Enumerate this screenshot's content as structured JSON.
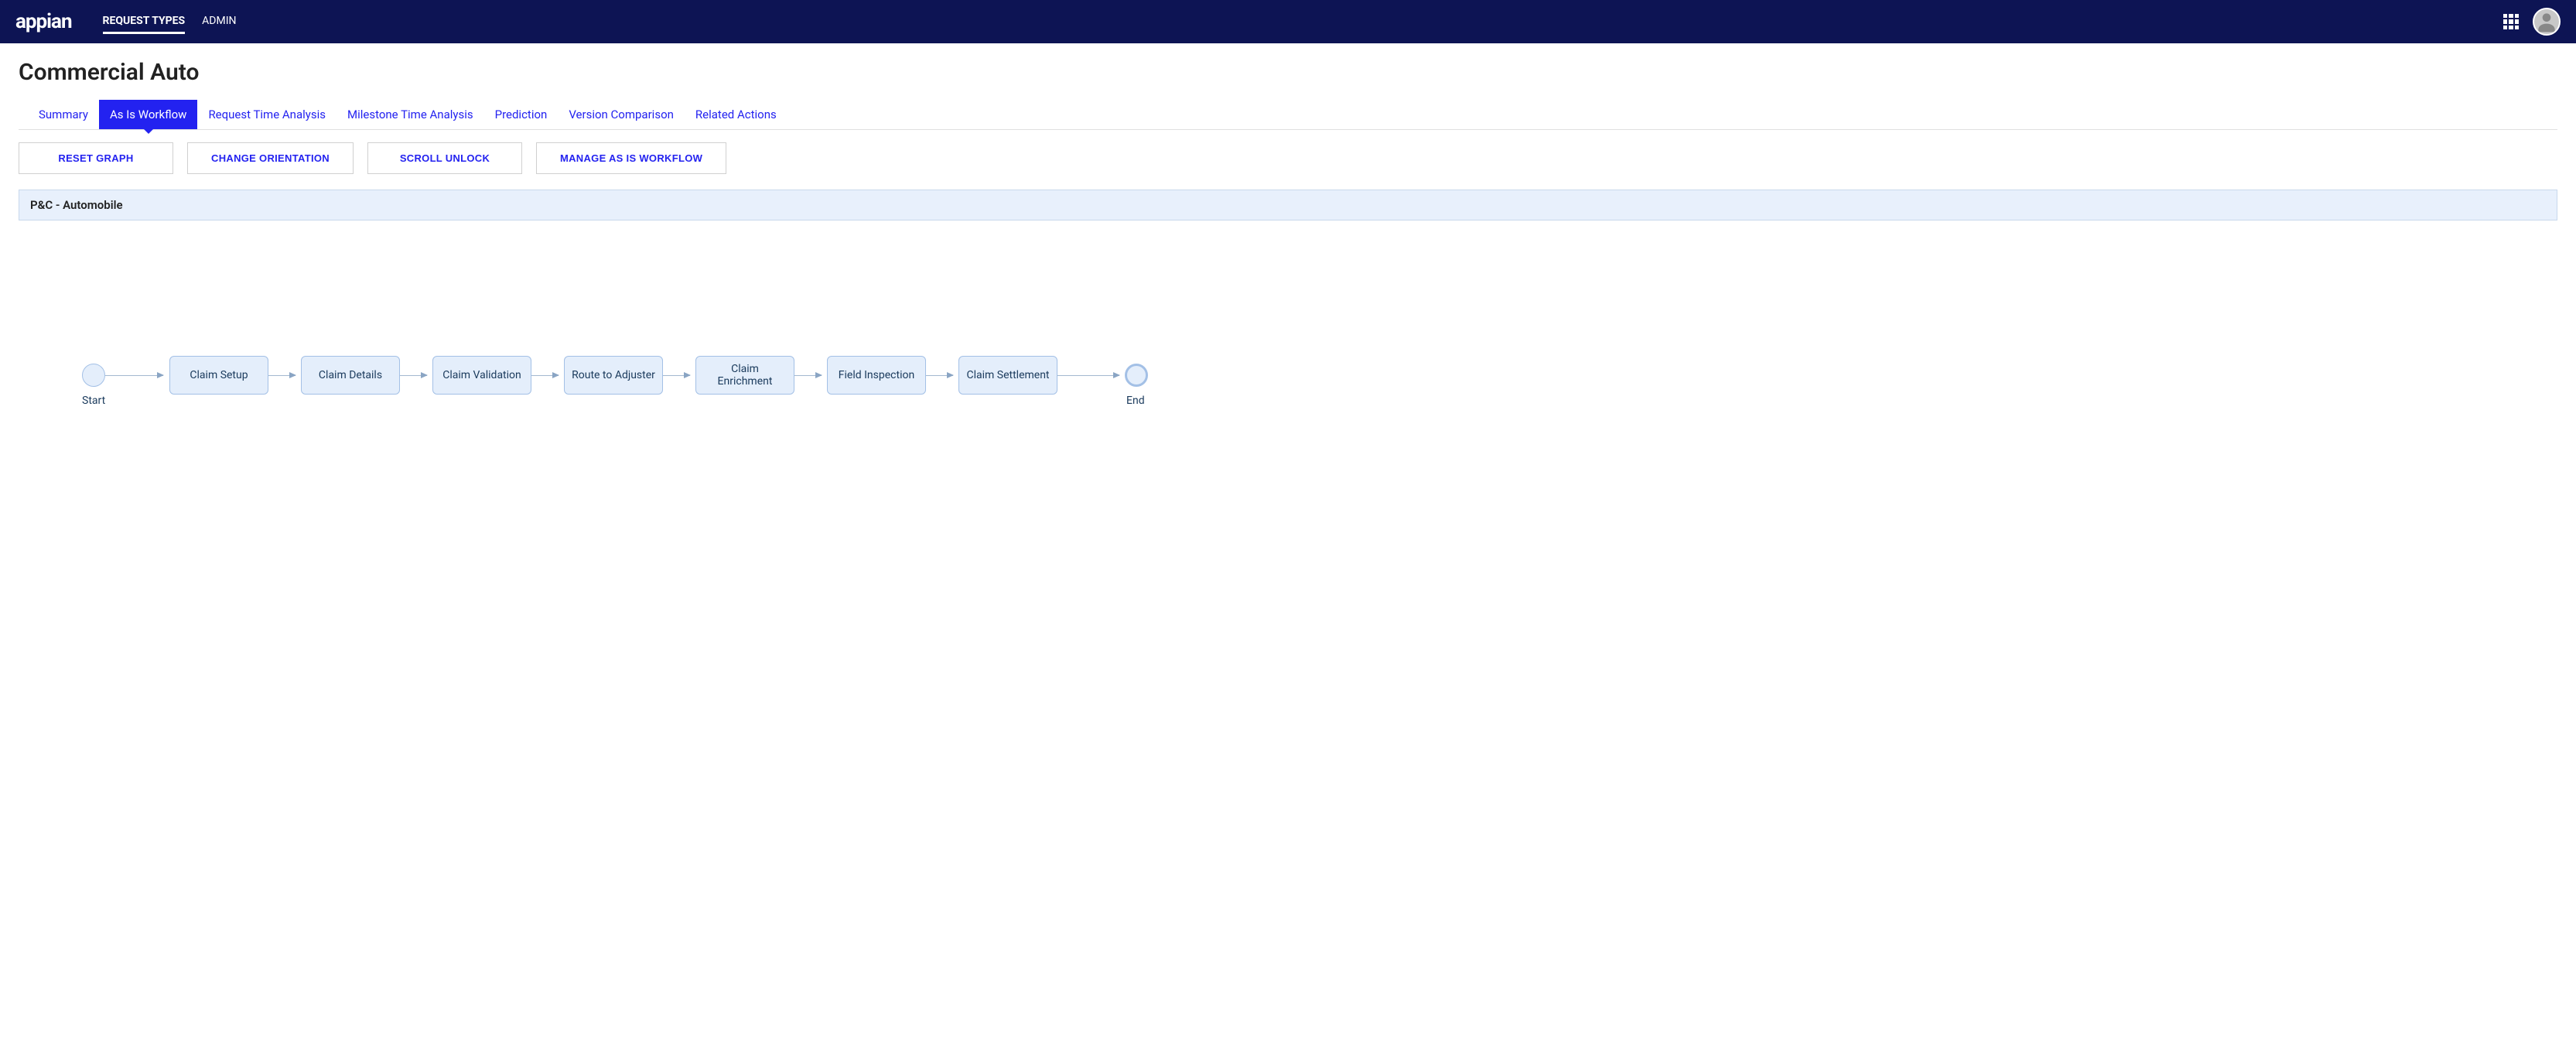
{
  "header": {
    "logo_text": "appian",
    "nav_items": [
      {
        "label": "REQUEST TYPES",
        "active": true
      },
      {
        "label": "ADMIN",
        "active": false
      }
    ]
  },
  "page": {
    "title": "Commercial Auto"
  },
  "tabs": [
    {
      "label": "Summary",
      "active": false
    },
    {
      "label": "As Is Workflow",
      "active": true
    },
    {
      "label": "Request Time Analysis",
      "active": false
    },
    {
      "label": "Milestone Time Analysis",
      "active": false
    },
    {
      "label": "Prediction",
      "active": false
    },
    {
      "label": "Version Comparison",
      "active": false
    },
    {
      "label": "Related Actions",
      "active": false
    }
  ],
  "actions": {
    "reset": "RESET GRAPH",
    "orientation": "CHANGE ORIENTATION",
    "scroll": "SCROLL UNLOCK",
    "manage": "MANAGE AS IS WORKFLOW"
  },
  "workflow": {
    "header": "P&C - Automobile",
    "start_label": "Start",
    "end_label": "End",
    "nodes": [
      {
        "label": "Claim Setup"
      },
      {
        "label": "Claim Details"
      },
      {
        "label": "Claim Validation"
      },
      {
        "label": "Route to Adjuster"
      },
      {
        "label": "Claim Enrichment"
      },
      {
        "label": "Field Inspection"
      },
      {
        "label": "Claim Settlement"
      }
    ]
  },
  "colors": {
    "nav_bg": "#0d1454",
    "accent": "#2322f0",
    "node_bg": "#e4eefb",
    "node_border": "#a3c0e6"
  }
}
